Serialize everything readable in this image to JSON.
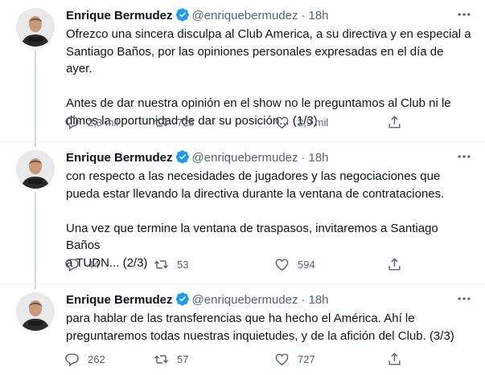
{
  "tweets": [
    {
      "author_name": "Enrique Bermudez",
      "handle": "@enriquebermudez",
      "separator": "·",
      "time": "18h",
      "text": "Ofrezco una sincera disculpa al Club America, a su directiva y en especial a\nSantiago Baños, por las opiniones personales expresadas en el día de ayer.\n\nAntes de dar nuestra opinión en el show no le preguntamos al Club ni le\ndimos la oportunidad de dar su posición... (1/3)",
      "replies": "2,3 mil",
      "retweets": "725",
      "likes": "2,9 mil"
    },
    {
      "author_name": "Enrique Bermudez",
      "handle": "@enriquebermudez",
      "separator": "·",
      "time": "18h",
      "text": "con respecto a las necesidades de jugadores y las negociaciones que\npueda estar llevando la directiva durante la ventana de contrataciones.\n\nUna vez que termine la ventana de traspasos, invitaremos a Santiago Baños\na TUDN... (2/3)",
      "replies": "44",
      "retweets": "53",
      "likes": "594"
    },
    {
      "author_name": "Enrique Bermudez",
      "handle": "@enriquebermudez",
      "separator": "·",
      "time": "18h",
      "text": "para hablar de las transferencias que ha hecho el América. Ahí le\npreguntaremos todas nuestras inquietudes, y de la afición del Club. (3/3)",
      "replies": "262",
      "retweets": "57",
      "likes": "727"
    }
  ],
  "avatar_logo_text": "TUDN",
  "icons": {
    "verified": "verified-badge-icon",
    "more": "more-icon",
    "reply": "reply-icon",
    "retweet": "retweet-icon",
    "like": "heart-icon",
    "share": "share-icon"
  },
  "colors": {
    "verified": "#1d9bf0",
    "secondary_text": "#536471",
    "primary_text": "#0f1419",
    "thread_line": "#cfd9de"
  }
}
